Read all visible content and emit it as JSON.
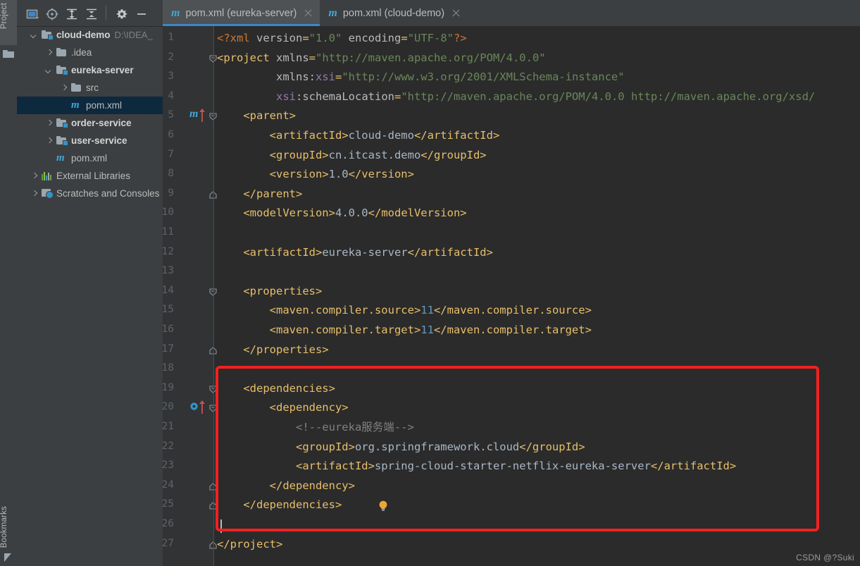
{
  "toolstrip": {
    "project_label": "Project",
    "bookmarks_label": "Bookmarks"
  },
  "project_toolbar": {
    "buttons": [
      {
        "name": "window-mode-icon",
        "title": ""
      },
      {
        "name": "locate-target-icon",
        "title": ""
      },
      {
        "name": "expand-all-icon",
        "title": ""
      },
      {
        "name": "collapse-all-icon",
        "title": ""
      },
      {
        "name": "settings-gear-icon",
        "title": ""
      },
      {
        "name": "hide-panel-icon",
        "title": ""
      }
    ]
  },
  "tree": {
    "rows": [
      {
        "label": "cloud-demo",
        "sub": "D:\\IDEA_",
        "icon": "module-folder",
        "arrow": "down",
        "indent": 0,
        "bold": true,
        "selected": false
      },
      {
        "label": ".idea",
        "sub": "",
        "icon": "folder",
        "arrow": "right",
        "indent": 1,
        "bold": false,
        "selected": false
      },
      {
        "label": "eureka-server",
        "sub": "",
        "icon": "module-folder",
        "arrow": "down",
        "indent": 1,
        "bold": true,
        "selected": false
      },
      {
        "label": "src",
        "sub": "",
        "icon": "folder",
        "arrow": "right",
        "indent": 2,
        "bold": false,
        "selected": false
      },
      {
        "label": "pom.xml",
        "sub": "",
        "icon": "maven",
        "arrow": "none",
        "indent": 2,
        "bold": false,
        "selected": true
      },
      {
        "label": "order-service",
        "sub": "",
        "icon": "module-folder",
        "arrow": "right",
        "indent": 1,
        "bold": true,
        "selected": false
      },
      {
        "label": "user-service",
        "sub": "",
        "icon": "module-folder",
        "arrow": "right",
        "indent": 1,
        "bold": true,
        "selected": false
      },
      {
        "label": "pom.xml",
        "sub": "",
        "icon": "maven",
        "arrow": "none",
        "indent": 1,
        "bold": false,
        "selected": false
      },
      {
        "label": "External Libraries",
        "sub": "",
        "icon": "ext-lib",
        "arrow": "right",
        "indent": 0,
        "bold": false,
        "selected": false
      },
      {
        "label": "Scratches and Consoles",
        "sub": "",
        "icon": "scratch",
        "arrow": "right",
        "indent": 0,
        "bold": false,
        "selected": false
      }
    ]
  },
  "editor_tabs": [
    {
      "label": "pom.xml (eureka-server)",
      "icon": "maven-icon",
      "active": true
    },
    {
      "label": "pom.xml (cloud-demo)",
      "icon": "maven-icon",
      "active": false
    }
  ],
  "code": {
    "file_name": "pom.xml",
    "language": "xml",
    "lines": [
      {
        "n": 1,
        "indent": 0,
        "segments": [
          {
            "t": "<?xml",
            "c": "t-qm"
          },
          {
            "t": " version",
            "c": "t-attr"
          },
          {
            "t": "=",
            "c": "t-punc"
          },
          {
            "t": "\"1.0\"",
            "c": "t-str"
          },
          {
            "t": " encoding",
            "c": "t-attr"
          },
          {
            "t": "=",
            "c": "t-punc"
          },
          {
            "t": "\"UTF-8\"",
            "c": "t-str"
          },
          {
            "t": "?>",
            "c": "t-qm"
          }
        ]
      },
      {
        "n": 2,
        "indent": 0,
        "segments": [
          {
            "t": "<project",
            "c": "t-tag"
          },
          {
            "t": " xmlns",
            "c": "t-attr"
          },
          {
            "t": "=",
            "c": "t-punc"
          },
          {
            "t": "\"http://maven.apache.org/POM/4.0.0\"",
            "c": "t-str"
          }
        ]
      },
      {
        "n": 3,
        "indent": 0,
        "segments": [
          {
            "t": "         xmlns:",
            "c": "t-attr"
          },
          {
            "t": "xsi",
            "c": "t-attr-ns"
          },
          {
            "t": "=",
            "c": "t-punc"
          },
          {
            "t": "\"http://www.w3.org/2001/XMLSchema-instance\"",
            "c": "t-str"
          }
        ]
      },
      {
        "n": 4,
        "indent": 0,
        "segments": [
          {
            "t": "         ",
            "c": "t-attr"
          },
          {
            "t": "xsi",
            "c": "t-attr-ns"
          },
          {
            "t": ":schemaLocation",
            "c": "t-attr"
          },
          {
            "t": "=",
            "c": "t-punc"
          },
          {
            "t": "\"http://maven.apache.org/POM/4.0.0 http://maven.apache.org/xsd/",
            "c": "t-str"
          }
        ]
      },
      {
        "n": 5,
        "indent": 0,
        "segments": [
          {
            "t": "    <parent>",
            "c": "t-tag"
          }
        ]
      },
      {
        "n": 6,
        "indent": 0,
        "segments": [
          {
            "t": "        <artifactId>",
            "c": "t-tag"
          },
          {
            "t": "cloud-demo",
            "c": "t-text"
          },
          {
            "t": "</artifactId>",
            "c": "t-tag"
          }
        ]
      },
      {
        "n": 7,
        "indent": 0,
        "segments": [
          {
            "t": "        <groupId>",
            "c": "t-tag"
          },
          {
            "t": "cn.itcast.demo",
            "c": "t-text"
          },
          {
            "t": "</groupId>",
            "c": "t-tag"
          }
        ]
      },
      {
        "n": 8,
        "indent": 0,
        "segments": [
          {
            "t": "        <version>",
            "c": "t-tag"
          },
          {
            "t": "1.0",
            "c": "t-text"
          },
          {
            "t": "</version>",
            "c": "t-tag"
          }
        ]
      },
      {
        "n": 9,
        "indent": 0,
        "segments": [
          {
            "t": "    </parent>",
            "c": "t-tag"
          }
        ]
      },
      {
        "n": 10,
        "indent": 0,
        "segments": [
          {
            "t": "    <modelVersion>",
            "c": "t-tag"
          },
          {
            "t": "4.0.0",
            "c": "t-text"
          },
          {
            "t": "</modelVersion>",
            "c": "t-tag"
          }
        ]
      },
      {
        "n": 11,
        "indent": 0,
        "segments": []
      },
      {
        "n": 12,
        "indent": 0,
        "segments": [
          {
            "t": "    <artifactId>",
            "c": "t-tag"
          },
          {
            "t": "eureka-server",
            "c": "t-text"
          },
          {
            "t": "</artifactId>",
            "c": "t-tag"
          }
        ]
      },
      {
        "n": 13,
        "indent": 0,
        "segments": []
      },
      {
        "n": 14,
        "indent": 0,
        "segments": [
          {
            "t": "    <properties>",
            "c": "t-tag"
          }
        ]
      },
      {
        "n": 15,
        "indent": 0,
        "segments": [
          {
            "t": "        <maven.compiler.source>",
            "c": "t-tag"
          },
          {
            "t": "11",
            "c": "t-num"
          },
          {
            "t": "</maven.compiler.source>",
            "c": "t-tag"
          }
        ]
      },
      {
        "n": 16,
        "indent": 0,
        "segments": [
          {
            "t": "        <maven.compiler.target>",
            "c": "t-tag"
          },
          {
            "t": "11",
            "c": "t-num"
          },
          {
            "t": "</maven.compiler.target>",
            "c": "t-tag"
          }
        ]
      },
      {
        "n": 17,
        "indent": 0,
        "segments": [
          {
            "t": "    </properties>",
            "c": "t-tag"
          }
        ]
      },
      {
        "n": 18,
        "indent": 0,
        "segments": []
      },
      {
        "n": 19,
        "indent": 0,
        "segments": [
          {
            "t": "    <dependencies>",
            "c": "t-tag"
          }
        ]
      },
      {
        "n": 20,
        "indent": 0,
        "segments": [
          {
            "t": "        <dependency>",
            "c": "t-tag"
          }
        ]
      },
      {
        "n": 21,
        "indent": 0,
        "segments": [
          {
            "t": "            <!--eureka服务端-->",
            "c": "t-cmt"
          }
        ]
      },
      {
        "n": 22,
        "indent": 0,
        "segments": [
          {
            "t": "            <groupId>",
            "c": "t-tag"
          },
          {
            "t": "org.springframework.cloud",
            "c": "t-text"
          },
          {
            "t": "</groupId>",
            "c": "t-tag"
          }
        ]
      },
      {
        "n": 23,
        "indent": 0,
        "segments": [
          {
            "t": "            <artifactId>",
            "c": "t-tag"
          },
          {
            "t": "spring-cloud-starter-netflix-eureka-server",
            "c": "t-text"
          },
          {
            "t": "</artifactId>",
            "c": "t-tag"
          }
        ]
      },
      {
        "n": 24,
        "indent": 0,
        "segments": [
          {
            "t": "        </dependency>",
            "c": "t-tag"
          }
        ]
      },
      {
        "n": 25,
        "indent": 0,
        "segments": [
          {
            "t": "    </dependencies>",
            "c": "t-tag"
          }
        ]
      },
      {
        "n": 26,
        "indent": 0,
        "segments": []
      },
      {
        "n": 27,
        "indent": 0,
        "segments": [
          {
            "t": "</project>",
            "c": "t-tag"
          }
        ]
      }
    ],
    "fold_markers": [
      {
        "line": 2,
        "type": "open"
      },
      {
        "line": 5,
        "type": "open"
      },
      {
        "line": 9,
        "type": "close"
      },
      {
        "line": 14,
        "type": "open"
      },
      {
        "line": 17,
        "type": "close"
      },
      {
        "line": 19,
        "type": "open"
      },
      {
        "line": 20,
        "type": "open"
      },
      {
        "line": 24,
        "type": "close"
      },
      {
        "line": 25,
        "type": "close"
      },
      {
        "line": 27,
        "type": "close"
      }
    ],
    "gutter_markers": [
      {
        "line": 5,
        "type": "maven-run-icon"
      },
      {
        "line": 20,
        "type": "bean-navigate-icon"
      },
      {
        "line": 25,
        "type": "intention-bulb-icon"
      }
    ],
    "caret": {
      "line": 26,
      "column": 1
    }
  },
  "annotation": {
    "type": "red-rectangle",
    "color": "#f42020",
    "covers_lines": "19-26"
  },
  "watermark": {
    "text": "CSDN @?Suki"
  },
  "colors": {
    "editor_bg": "#2b2b2b",
    "panel_bg": "#3c3f41",
    "gutter_bg": "#313335",
    "selection_bg": "#0d293e",
    "tab_active_bg": "#4e5254",
    "tab_underline": "#3d87c8",
    "accent_blue": "#41a7d8",
    "annotation_red": "#f42020"
  }
}
